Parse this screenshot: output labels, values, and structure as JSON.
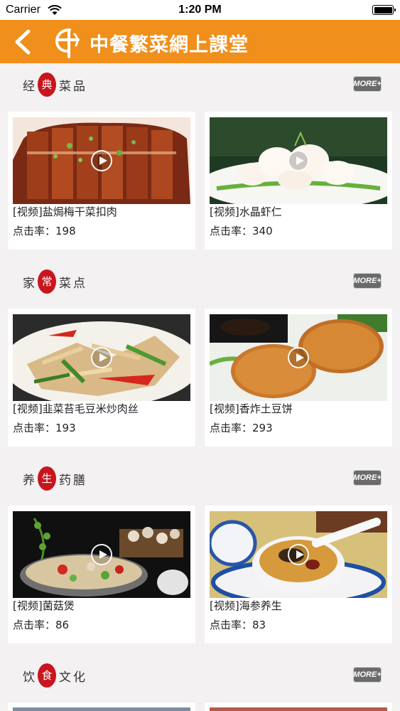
{
  "status": {
    "carrier": "Carrier",
    "time": "1:20 PM"
  },
  "nav": {
    "title": "中餐繁菜網上課堂"
  },
  "sections": [
    {
      "title_chars": [
        "经",
        "典",
        "菜",
        "品"
      ],
      "more_label": "MORE+",
      "items": [
        {
          "title": "[视频]盐焗梅干菜扣肉",
          "hits": "点击率：198"
        },
        {
          "title": "[视频]水晶虾仁",
          "hits": "点击率：340"
        }
      ]
    },
    {
      "title_chars": [
        "家",
        "常",
        "菜",
        "点"
      ],
      "more_label": "MORE+",
      "items": [
        {
          "title": "[视频]韭菜苔毛豆米炒肉丝",
          "hits": "点击率：193"
        },
        {
          "title": "[视频]香炸土豆饼",
          "hits": "点击率：293"
        }
      ]
    },
    {
      "title_chars": [
        "养",
        "生",
        "药",
        "膳"
      ],
      "more_label": "MORE+",
      "items": [
        {
          "title": "[视频]菌菇煲",
          "hits": "点击率：86"
        },
        {
          "title": "[视频]海参养生",
          "hits": "点击率：83"
        }
      ]
    },
    {
      "title_chars": [
        "饮",
        "食",
        "文",
        "化"
      ],
      "more_label": "MORE+",
      "items": []
    }
  ],
  "colors": {
    "nav_bg": "#f08f1b",
    "highlight": "#c9151e",
    "page_bg": "#f3f1f1"
  }
}
